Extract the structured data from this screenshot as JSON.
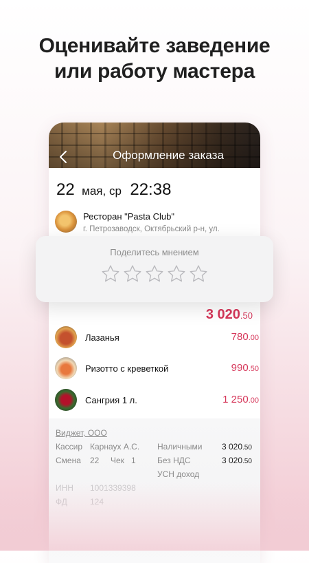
{
  "headline": {
    "line1": "Оценивайте заведение",
    "line2": "или работу мастера"
  },
  "order": {
    "title": "Оформление заказа",
    "date": {
      "day": "22",
      "month_weekday": "мая, ср",
      "time": "22:38"
    },
    "restaurant": {
      "name": "Ресторан \"Pasta Club\"",
      "address": "г. Петрозаводск, Октябрьский р-н, ул."
    },
    "total": {
      "int": "3 020",
      "dec": ".50"
    },
    "items": [
      {
        "name": "Лазанья",
        "price_int": "780",
        "price_dec": ".00"
      },
      {
        "name": "Ризотто с креветкой",
        "price_int": "990",
        "price_dec": ".50"
      },
      {
        "name": "Сангрия 1 л.",
        "price_int": "1 250",
        "price_dec": ".00"
      }
    ]
  },
  "rating": {
    "title": "Поделитесь мнением",
    "star_count": 5,
    "selected": 0
  },
  "receipt": {
    "company": "Виджет, ООО",
    "cashier_label": "Кассир",
    "cashier_value": "Карнаух А.С.",
    "shift_label": "Смена",
    "shift_value": "22",
    "check_label": "Чек",
    "check_value": "1",
    "cash_label": "Наличными",
    "cash_value_int": "3 020",
    "cash_value_dec": ".50",
    "vat_label": "Без НДС",
    "vat_value_int": "3 020",
    "vat_value_dec": ".50",
    "tax_label": "УСН доход",
    "inn_label": "ИНН",
    "inn_value": "1001339398",
    "fd_label": "ФД",
    "fd_value": "124"
  },
  "colors": {
    "accent": "#d6375a",
    "star_outline": "#b9b9bd"
  }
}
